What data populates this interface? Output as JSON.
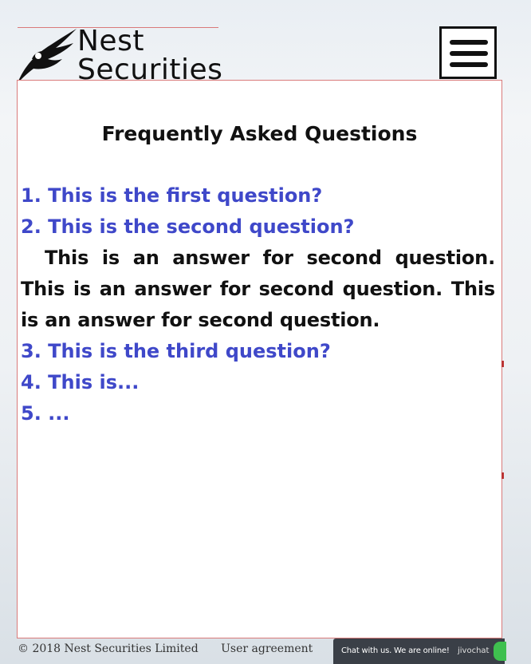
{
  "brand": {
    "line1": "Nest",
    "line2": "Securities"
  },
  "menu": {
    "icon": "hamburger-icon"
  },
  "faq": {
    "title": "Frequently Asked Questions",
    "items": [
      {
        "question": "1. This is the first question?"
      },
      {
        "question": "2. This is the second question?",
        "answer": "This is an answer for second question. This is an answer for second question. This is an answer for second question."
      },
      {
        "question": "3. This is the third question?"
      },
      {
        "question": "4. This is..."
      },
      {
        "question": "5. ..."
      }
    ]
  },
  "footer": {
    "copyright": "© 2018 Nest Securities Limited",
    "agreement": "User agreement"
  },
  "chat": {
    "label": "Chat with us. We are online!",
    "brand": "jivochat"
  },
  "colors": {
    "question": "#3f48c9",
    "text": "#111111",
    "border": "#d97a7a",
    "chat_bg": "#3a3f47",
    "online": "#3fc04f"
  }
}
